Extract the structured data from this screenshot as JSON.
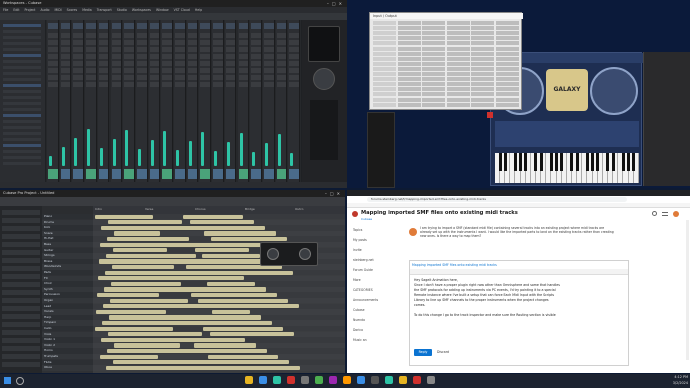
{
  "desktop": {
    "wallpaper_color": "#0d1a33"
  },
  "cubase_top": {
    "title": "Workspaces - Cubase",
    "menu": [
      "File",
      "Edit",
      "Project",
      "Audio",
      "MIDI",
      "Scores",
      "Media",
      "Transport",
      "Studio",
      "Workspaces",
      "Window",
      "VST Cloud",
      "Help"
    ],
    "accent": "#2ec4a6"
  },
  "plugin_table": {
    "title": "Input / Output"
  },
  "instrument_plugin": {
    "logo": "GALAXY",
    "brand_color": "#2a4a8a"
  },
  "cubase_bottom": {
    "title": "Cubase Pro Project - Untitled",
    "track_names": [
      "Piano",
      "Drums",
      "Kick",
      "Snare",
      "Hi-Hat",
      "Bass",
      "Guitar",
      "Strings",
      "Brass",
      "Woodwinds",
      "Pads",
      "FX",
      "Choir",
      "Synth",
      "Percussion",
      "Organ",
      "Lead",
      "Vocals",
      "Harp",
      "Timpani",
      "Cello",
      "Viola",
      "Violin 1",
      "Violin 2",
      "Horns",
      "Trumpets",
      "Flute",
      "Oboe"
    ],
    "section_markers": [
      "Intro",
      "Verse",
      "Chorus",
      "Bridge",
      "Outro"
    ],
    "clip_color": "#c8c29a"
  },
  "browser": {
    "tab_title": "Mapping imported SMF files onto existing midi tracks",
    "url": "forums.steinberg.net/t/mapping-imported-smf-files-onto-existing-midi-tracks",
    "page_title": "Mapping imported SMF files onto existing midi tracks",
    "category": "Cubase",
    "sidebar": [
      "Topics",
      "My posts",
      "Invite",
      "steinberg.net",
      "Forum Guide",
      "More",
      "CATEGORIES",
      "Announcements",
      "Cubase",
      "Nuendo",
      "Dorico",
      "Music an"
    ],
    "post_intro": "I am trying to import a SMF (standard midi file) containing several tracks into an existing project where midi tracks are already set up with the instruments I want. I would like the imported parts to land on the existing tracks rather than creating new ones. Is there a way to map them?",
    "reply_header": "Mapping imported SMF files onto existing midi tracks",
    "reply_lines": [
      "Hey Sageit Animation here,",
      "Since I don't have a proper plugin right now other than Omnisphere and some that handles",
      "the SMF protocols for adding up instruments via PC events, I'd try pointing it to a special",
      "Remote instance where I've built a setup that can force Each Midi Input with the Scripts",
      "Library to line up SMF channels to the proper instruments when the project changes",
      "comes.",
      "",
      "To do this change I go to the track inspector and make sure the Routing section is visible"
    ],
    "reply_button": "Reply",
    "discard_label": "Discard",
    "accent": "#0a73d1"
  },
  "taskbar": {
    "time": "4:12 PM",
    "date": "3/2/2024"
  }
}
